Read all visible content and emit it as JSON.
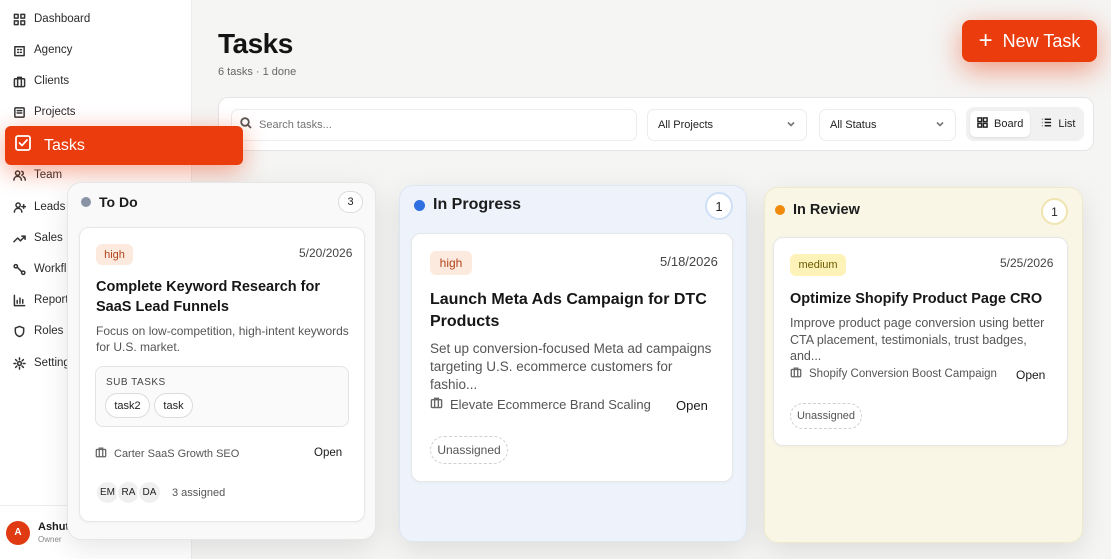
{
  "sidebar": {
    "items": [
      {
        "label": "Dashboard",
        "icon": "grid-icon"
      },
      {
        "label": "Agency",
        "icon": "building-icon"
      },
      {
        "label": "Clients",
        "icon": "briefcase-icon"
      },
      {
        "label": "Projects",
        "icon": "folder-icon"
      },
      {
        "label": "Tasks",
        "icon": "checkbox-icon"
      },
      {
        "label": "Team",
        "icon": "users-icon"
      },
      {
        "label": "Leads",
        "icon": "user-plus-icon"
      },
      {
        "label": "Sales",
        "icon": "trend-icon"
      },
      {
        "label": "Workfl",
        "icon": "workflow-icon"
      },
      {
        "label": "Report",
        "icon": "bar-chart-icon"
      },
      {
        "label": "Roles &",
        "icon": "shield-icon"
      },
      {
        "label": "Setting",
        "icon": "gear-icon"
      }
    ],
    "user": {
      "initial": "A",
      "name": "Ashut",
      "role": "Owner"
    }
  },
  "header": {
    "title": "Tasks",
    "subtitle": "6 tasks · 1 done",
    "new_task_label": "New Task"
  },
  "filters": {
    "search_placeholder": "Search tasks...",
    "project_select": "All Projects",
    "status_select": "All Status",
    "view_board": "Board",
    "view_list": "List"
  },
  "columns": {
    "todo": {
      "title": "To Do",
      "count": "3",
      "color": "#8a93a6",
      "card": {
        "priority": "high",
        "date": "5/20/2026",
        "title": "Complete Keyword Research for SaaS Lead Funnels",
        "desc": "Focus on low-competition, high-intent keywords for U.S. market.",
        "subtasks_label": "SUB TASKS",
        "subtasks": [
          "task2",
          "task"
        ],
        "project": "Carter SaaS Growth SEO",
        "status": "Open",
        "assignees": [
          "EM",
          "RA",
          "DA"
        ],
        "assigned_text": "3 assigned"
      }
    },
    "progress": {
      "title": "In Progress",
      "count": "1",
      "color": "#2f6fe0",
      "card": {
        "priority": "high",
        "date": "5/18/2026",
        "title": "Launch Meta Ads Campaign for DTC Products",
        "desc": "Set up conversion-focused Meta ad campaigns targeting U.S. ecommerce customers for fashio...",
        "project": "Elevate Ecommerce Brand Scaling",
        "status": "Open",
        "assignee": "Unassigned"
      }
    },
    "review": {
      "title": "In Review",
      "count": "1",
      "color": "#f08a0c",
      "card": {
        "priority": "medium",
        "date": "5/25/2026",
        "title": "Optimize Shopify Product Page CRO",
        "desc": "Improve product page conversion using better CTA placement, testimonials, trust badges, and...",
        "project": "Shopify Conversion Boost Campaign",
        "status": "Open",
        "assignee": "Unassigned"
      }
    }
  }
}
